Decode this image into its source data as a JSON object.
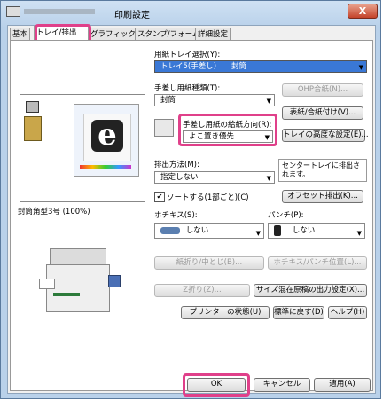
{
  "window": {
    "title": "印刷設定",
    "close_label": "X"
  },
  "tabs": [
    "基本",
    "トレイ/排出",
    "グラフィックス",
    "スタンプ/フォーム",
    "詳細設定"
  ],
  "paper_tray": {
    "label": "用紙トレイ選択(Y):",
    "value": "トレイ5(手差し)　　封筒"
  },
  "bypass_type": {
    "label": "手差し用紙種類(T):",
    "value": "封筒"
  },
  "ohp_button": "OHP合紙(N)...",
  "cover_button": "表紙/合紙付け(V)...",
  "feed_dir": {
    "label": "手差し用紙の給紙方向(R):",
    "value": "よこ置き優先"
  },
  "tray_adv_button": "トレイの高度な設定(E)...",
  "paper_info": "封筒角型3号 (100%)",
  "output": {
    "label": "排出方法(M):",
    "value": "指定しない",
    "info": "センタートレイに排出されます。"
  },
  "collate": {
    "label": "ソートする(1部ごと)(C)",
    "checked": true
  },
  "offset_button": "オフセット排出(K)...",
  "staple": {
    "label": "ホチキス(S):",
    "value": "しない"
  },
  "punch": {
    "label": "パンチ(P):",
    "value": "しない"
  },
  "fold_button": "紙折り/中とじ(B)...",
  "staple_pos_button": "ホチキス/パンチ位置(L)...",
  "zfold_button": "Z折り(Z)...",
  "mixed_size_button": "サイズ混在原稿の出力設定(X)...",
  "printer_status_button": "プリンターの状態(U)",
  "defaults_button": "標準に戻す(D)",
  "help_button": "ヘルプ(H)",
  "footer": {
    "ok": "OK",
    "cancel": "キャンセル",
    "apply": "適用(A)"
  },
  "preview": {
    "logo_letter": "e"
  }
}
